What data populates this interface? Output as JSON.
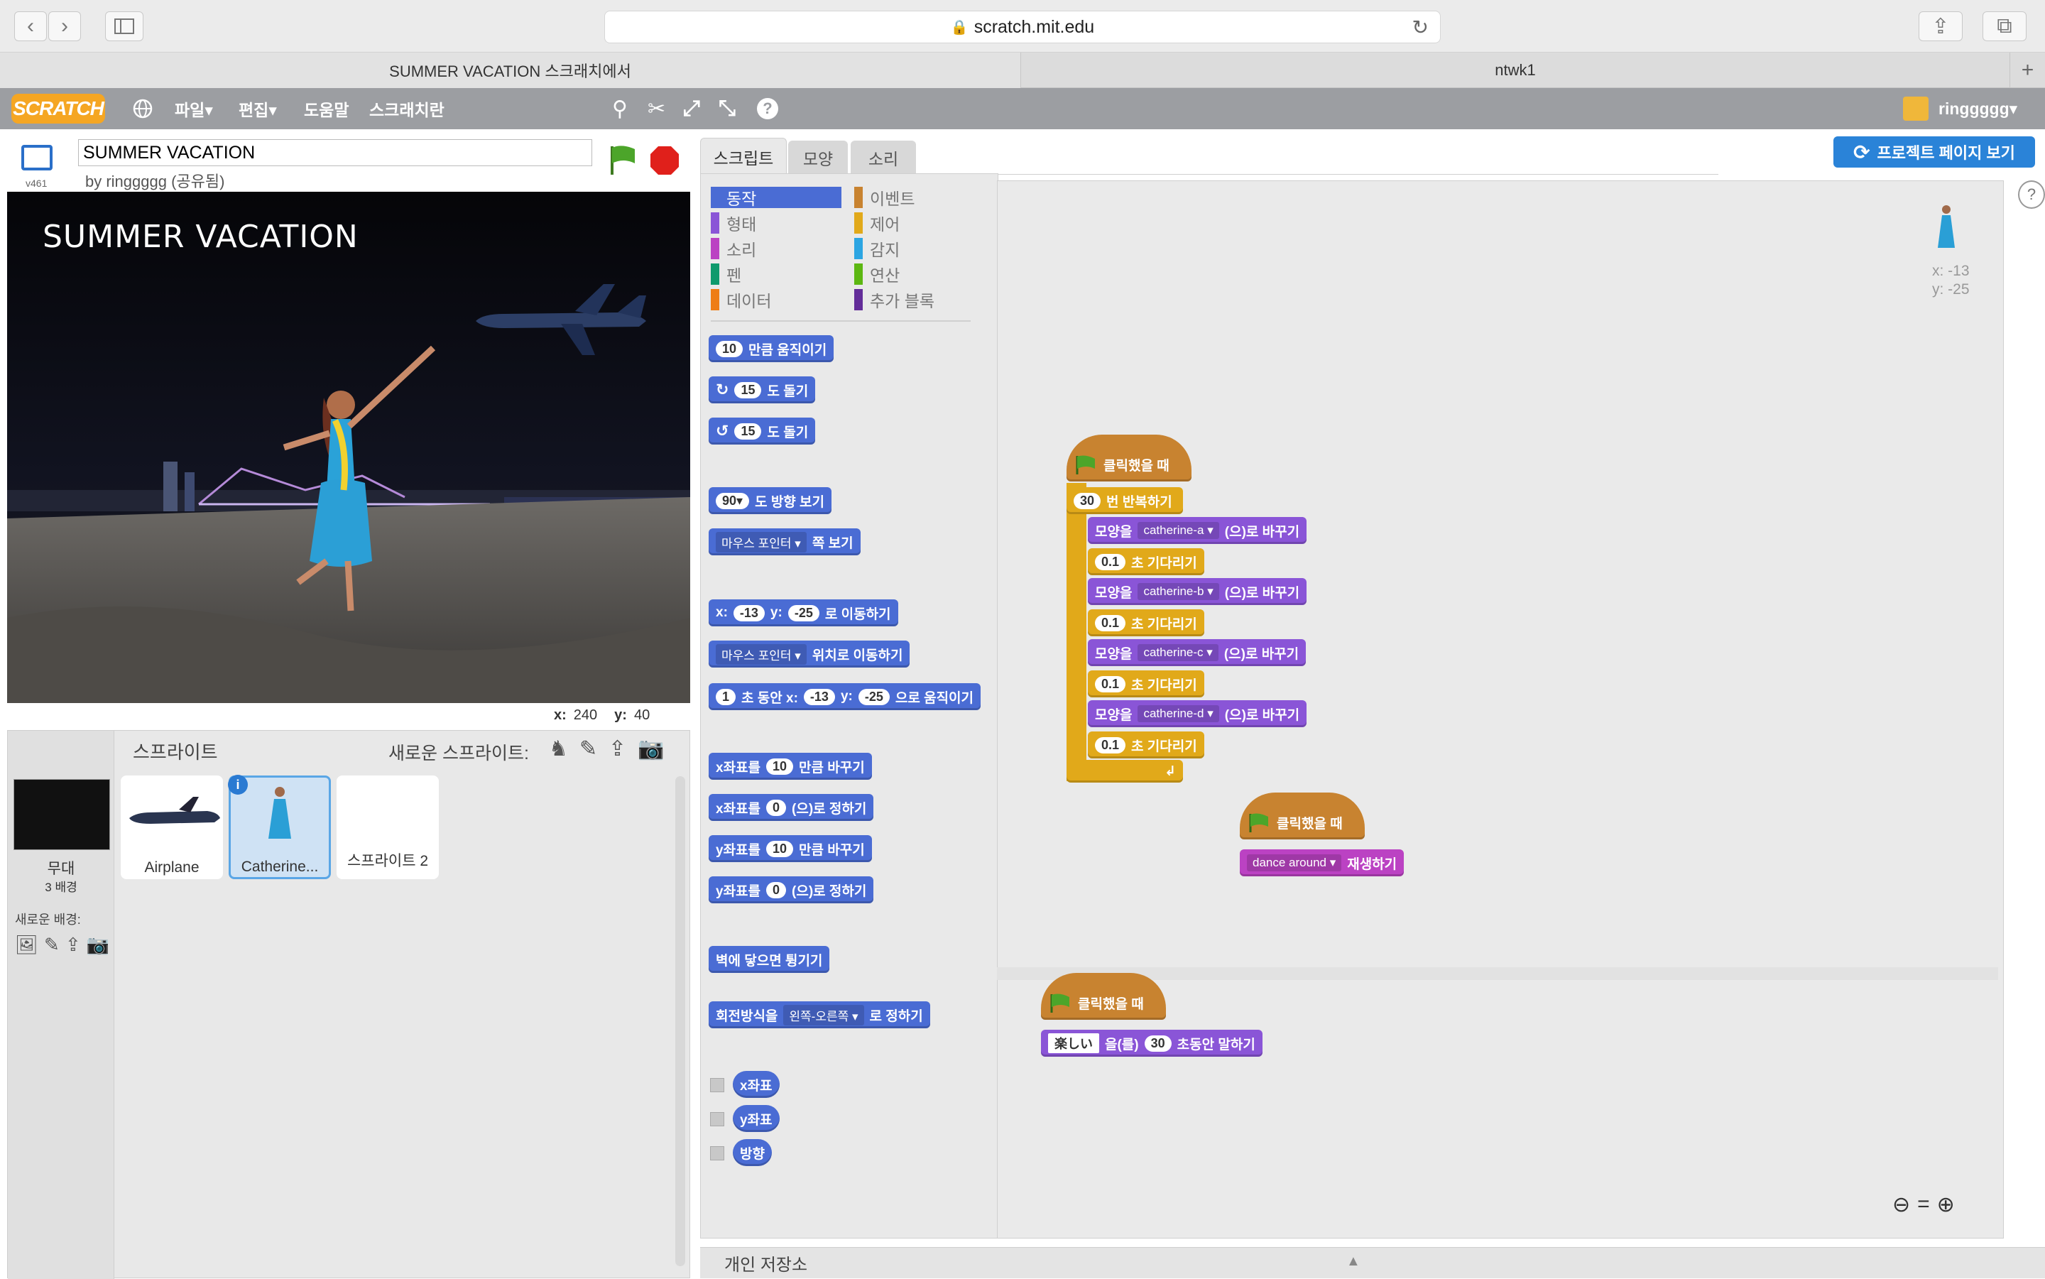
{
  "browser": {
    "url": "scratch.mit.edu",
    "tabs": [
      "SUMMER VACATION 스크래치에서",
      "ntwk1"
    ],
    "new_tab": "+"
  },
  "menu": {
    "logo": "SCRATCH",
    "items": [
      "파일▾",
      "편집▾",
      "도움말",
      "스크래치란"
    ],
    "user": "ringgggg▾",
    "project_page_button": "프로젝트 페이지 보기"
  },
  "project": {
    "title": "SUMMER VACATION",
    "author": "by ringgggg (공유됨)",
    "version": "v461",
    "stage_text": "SUMMER VACATION",
    "mouse_x_label": "x:",
    "mouse_x": "240",
    "mouse_y_label": "y:",
    "mouse_y": "40"
  },
  "tabs": [
    "스크립트",
    "모양",
    "소리"
  ],
  "categories_left": [
    "동작",
    "형태",
    "소리",
    "펜",
    "데이터"
  ],
  "categories_right": [
    "이벤트",
    "제어",
    "감지",
    "연산",
    "추가 블록"
  ],
  "colors": {
    "motion": "#4a6cd4",
    "looks": "#8a55d7",
    "sound": "#bb42c3",
    "pen": "#0e9a6c",
    "data": "#ee7d16",
    "events": "#c88330",
    "control": "#e1a91a",
    "sensing": "#2ca5e2",
    "operators": "#5cb712",
    "more": "#632d99"
  },
  "palette": {
    "move": [
      "10",
      "만큼 움직이기"
    ],
    "turn_cw": [
      "15",
      "도 돌기"
    ],
    "turn_ccw": [
      "15",
      "도 돌기"
    ],
    "point_dir": [
      "90▾",
      "도 방향 보기"
    ],
    "point_towards": [
      "마우스 포인터 ▾",
      "쪽 보기"
    ],
    "goto_xy": [
      "x:",
      "-13",
      "y:",
      "-25",
      "로 이동하기"
    ],
    "goto": [
      "마우스 포인터 ▾",
      "위치로 이동하기"
    ],
    "glide": [
      "1",
      "초 동안 x:",
      "-13",
      "y:",
      "-25",
      "으로 움직이기"
    ],
    "change_x": [
      "x좌표를",
      "10",
      "만큼 바꾸기"
    ],
    "set_x": [
      "x좌표를",
      "0",
      "(으)로 정하기"
    ],
    "change_y": [
      "y좌표를",
      "10",
      "만큼 바꾸기"
    ],
    "set_y": [
      "y좌표를",
      "0",
      "(으)로 정하기"
    ],
    "bounce": "벽에 닿으면 튕기기",
    "rotation": [
      "회전방식을",
      "왼쪽-오른쪽 ▾",
      "로 정하기"
    ],
    "reporters": [
      "x좌표",
      "y좌표",
      "방향"
    ]
  },
  "sprite_info": {
    "x": "x: -13",
    "y": "y: -25"
  },
  "scripts": {
    "when_flag": "클릭했을 때",
    "repeat": [
      "30",
      "번 반복하기"
    ],
    "switch_costume": "모양을",
    "to_suffix": "(으)로 바꾸기",
    "costumes": [
      "catherine-a ▾",
      "catherine-b ▾",
      "catherine-c ▾",
      "catherine-d ▾"
    ],
    "wait": [
      "0.1",
      "초 기다리기"
    ],
    "play_sound": [
      "dance around ▾",
      "재생하기"
    ],
    "say": [
      "楽しい",
      "을(를)",
      "30",
      "초동안 말하기"
    ]
  },
  "sprites_panel": {
    "title": "스프라이트",
    "new_sprite": "새로운 스프라이트:",
    "stage_label": "무대",
    "backdrops": "3 배경",
    "new_backdrop": "새로운 배경:",
    "sprites": [
      "Airplane",
      "Catherine...",
      "스프라이트 2"
    ]
  },
  "backpack": "개인 저장소"
}
